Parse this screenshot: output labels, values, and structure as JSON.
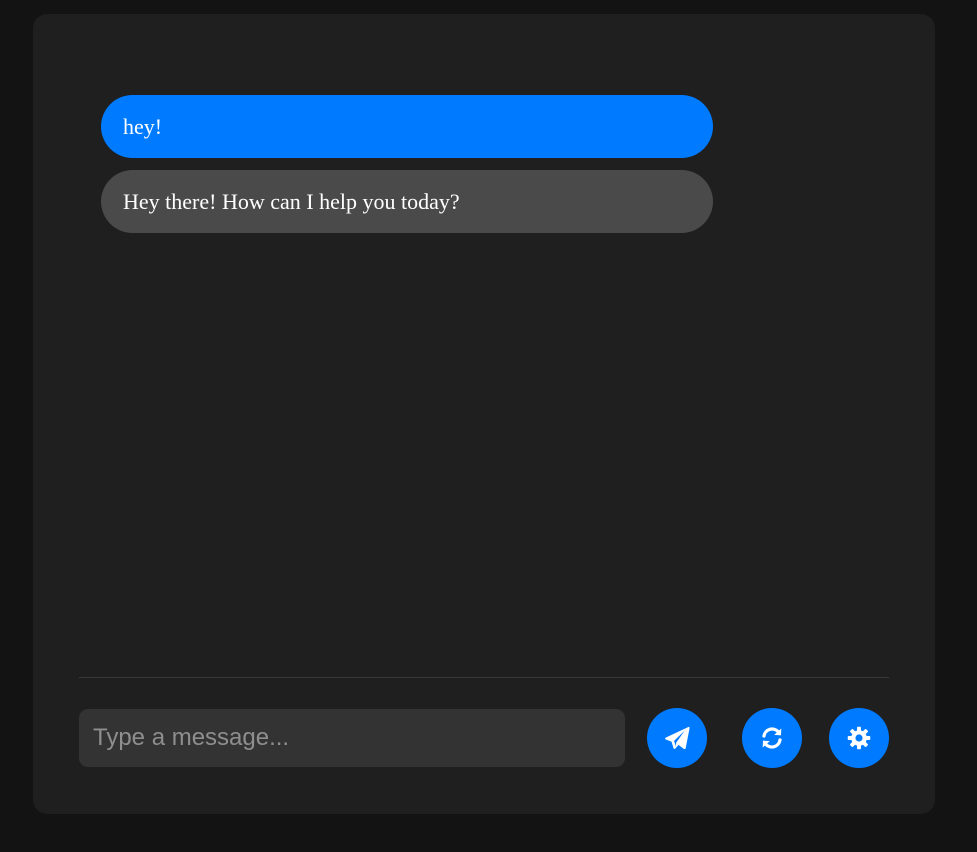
{
  "conversation": {
    "messages": [
      {
        "role": "user",
        "text": "hey!"
      },
      {
        "role": "assistant",
        "text": "Hey there! How can I help you today?"
      }
    ]
  },
  "composer": {
    "placeholder": "Type a message...",
    "value": ""
  },
  "buttons": {
    "send": {
      "icon": "paper-plane-icon"
    },
    "refresh": {
      "icon": "refresh-icon"
    },
    "settings": {
      "icon": "gear-icon"
    }
  },
  "colors": {
    "accent": "#007bff",
    "user_bubble": "#007bff",
    "assistant_bubble": "#4a4a4a",
    "panel": "#1f1f1f",
    "background": "#131313",
    "input": "#333333"
  }
}
